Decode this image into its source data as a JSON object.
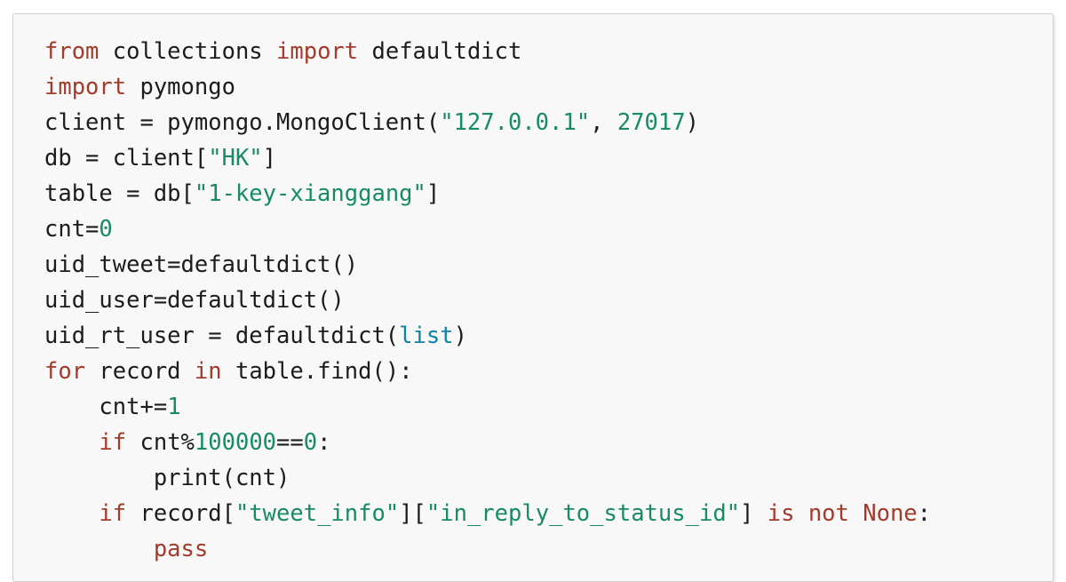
{
  "document": {
    "type": "code-snippet",
    "language": "python",
    "background_color": "#ffffff",
    "code_background_color": "#f8f8f8",
    "border_color": "#cfcfcf"
  },
  "theme": {
    "keyword_color": "#a23b2b",
    "string_color": "#178c63",
    "number_color": "#178c63",
    "builtin_color": "#0e82ab",
    "plain_color": "#1c1c1c"
  },
  "code": {
    "lines": [
      {
        "indent": "",
        "tokens": [
          {
            "t": "from",
            "c": "kw"
          },
          {
            "t": " collections ",
            "c": "pln"
          },
          {
            "t": "import",
            "c": "kw"
          },
          {
            "t": " defaultdict",
            "c": "pln"
          }
        ]
      },
      {
        "indent": "",
        "tokens": [
          {
            "t": "import",
            "c": "kw"
          },
          {
            "t": " pymongo",
            "c": "pln"
          }
        ]
      },
      {
        "indent": "",
        "tokens": [
          {
            "t": "client = pymongo.MongoClient(",
            "c": "pln"
          },
          {
            "t": "\"127.0.0.1\"",
            "c": "str"
          },
          {
            "t": ", ",
            "c": "pln"
          },
          {
            "t": "27017",
            "c": "num"
          },
          {
            "t": ")",
            "c": "pln"
          }
        ]
      },
      {
        "indent": "",
        "tokens": [
          {
            "t": "db = client[",
            "c": "pln"
          },
          {
            "t": "\"HK\"",
            "c": "str"
          },
          {
            "t": "]",
            "c": "pln"
          }
        ]
      },
      {
        "indent": "",
        "tokens": [
          {
            "t": "table = db[",
            "c": "pln"
          },
          {
            "t": "\"1-key-xianggang\"",
            "c": "str"
          },
          {
            "t": "]",
            "c": "pln"
          }
        ]
      },
      {
        "indent": "",
        "tokens": [
          {
            "t": "cnt=",
            "c": "pln"
          },
          {
            "t": "0",
            "c": "num"
          }
        ]
      },
      {
        "indent": "",
        "tokens": [
          {
            "t": "uid_tweet=defaultdict()",
            "c": "pln"
          }
        ]
      },
      {
        "indent": "",
        "tokens": [
          {
            "t": "uid_user=defaultdict()",
            "c": "pln"
          }
        ]
      },
      {
        "indent": "",
        "tokens": [
          {
            "t": "uid_rt_user = defaultdict(",
            "c": "pln"
          },
          {
            "t": "list",
            "c": "bif"
          },
          {
            "t": ")",
            "c": "pln"
          }
        ]
      },
      {
        "indent": "",
        "tokens": [
          {
            "t": "for",
            "c": "kw"
          },
          {
            "t": " record ",
            "c": "pln"
          },
          {
            "t": "in",
            "c": "kw"
          },
          {
            "t": " table.find():",
            "c": "pln"
          }
        ]
      },
      {
        "indent": "    ",
        "tokens": [
          {
            "t": "cnt+=",
            "c": "pln"
          },
          {
            "t": "1",
            "c": "num"
          }
        ]
      },
      {
        "indent": "    ",
        "tokens": [
          {
            "t": "if",
            "c": "kw"
          },
          {
            "t": " cnt%",
            "c": "pln"
          },
          {
            "t": "100000",
            "c": "num"
          },
          {
            "t": "==",
            "c": "pln"
          },
          {
            "t": "0",
            "c": "num"
          },
          {
            "t": ":",
            "c": "pln"
          }
        ]
      },
      {
        "indent": "        ",
        "tokens": [
          {
            "t": "print(cnt)",
            "c": "pln"
          }
        ]
      },
      {
        "indent": "    ",
        "tokens": [
          {
            "t": "if",
            "c": "kw"
          },
          {
            "t": " record[",
            "c": "pln"
          },
          {
            "t": "\"tweet_info\"",
            "c": "str"
          },
          {
            "t": "][",
            "c": "pln"
          },
          {
            "t": "\"in_reply_to_status_id\"",
            "c": "str"
          },
          {
            "t": "] ",
            "c": "pln"
          },
          {
            "t": "is",
            "c": "kw"
          },
          {
            "t": " ",
            "c": "pln"
          },
          {
            "t": "not",
            "c": "kw"
          },
          {
            "t": " ",
            "c": "pln"
          },
          {
            "t": "None",
            "c": "kw"
          },
          {
            "t": ":",
            "c": "pln"
          }
        ]
      },
      {
        "indent": "        ",
        "tokens": [
          {
            "t": "pass",
            "c": "kw"
          }
        ]
      }
    ]
  }
}
